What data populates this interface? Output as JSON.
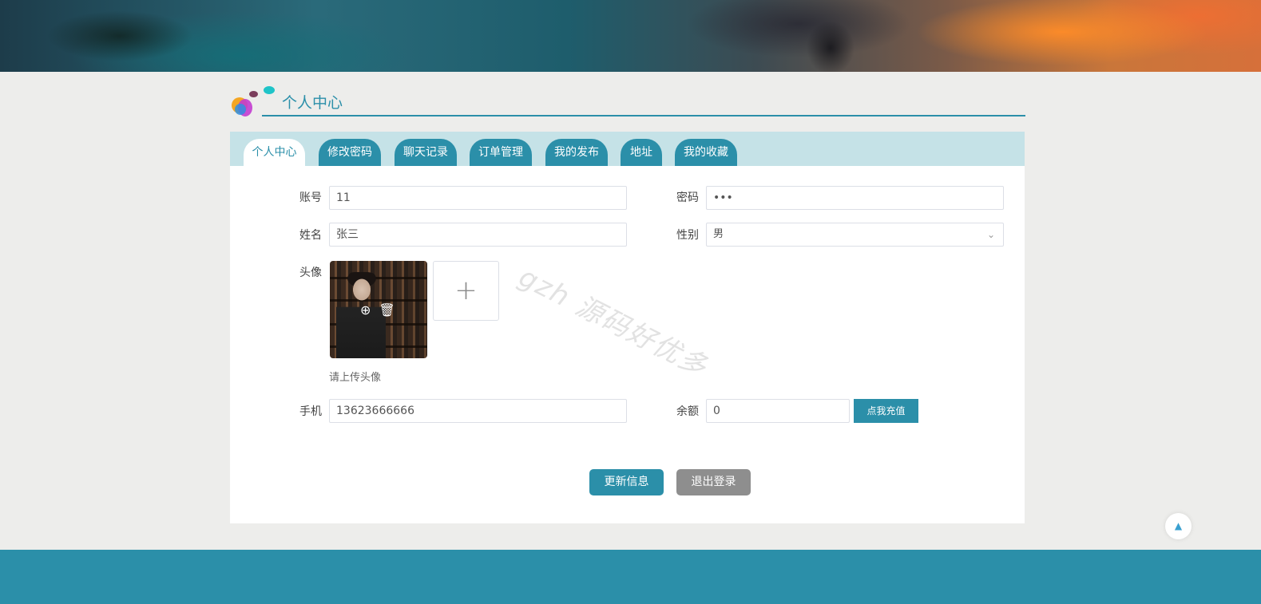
{
  "header": {
    "title": "个人中心"
  },
  "tabs": [
    {
      "label": "个人中心",
      "active": true
    },
    {
      "label": "修改密码",
      "active": false
    },
    {
      "label": "聊天记录",
      "active": false
    },
    {
      "label": "订单管理",
      "active": false
    },
    {
      "label": "我的发布",
      "active": false
    },
    {
      "label": "地址",
      "active": false
    },
    {
      "label": "我的收藏",
      "active": false
    }
  ],
  "form": {
    "account": {
      "label": "账号",
      "value": "11"
    },
    "password": {
      "label": "密码",
      "value": "•••"
    },
    "name": {
      "label": "姓名",
      "value": "张三"
    },
    "gender": {
      "label": "性别",
      "value": "男"
    },
    "avatar": {
      "label": "头像",
      "hint": "请上传头像"
    },
    "phone": {
      "label": "手机",
      "value": "13623666666"
    },
    "balance": {
      "label": "余额",
      "value": "0",
      "recharge_label": "点我充值"
    }
  },
  "actions": {
    "update_label": "更新信息",
    "logout_label": "退出登录"
  },
  "watermark": "gzh 源码好优多",
  "icons": {
    "zoom": "zoom-in-icon",
    "delete": "trash-icon",
    "add": "plus-icon",
    "back_to_top": "arrow-up-icon"
  },
  "colors": {
    "primary": "#2b8fa9",
    "tabbar_bg": "#c5e2e7",
    "logout": "#8e8e8e",
    "page_bg": "#ededeb"
  }
}
